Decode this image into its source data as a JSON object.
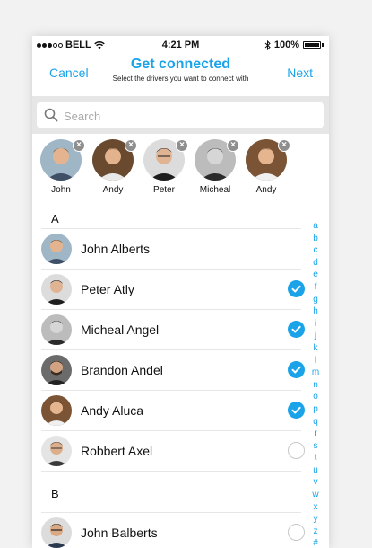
{
  "status_bar": {
    "carrier": "BELL",
    "time": "4:21 PM",
    "battery": "100%"
  },
  "nav": {
    "cancel": "Cancel",
    "title": "Get connected",
    "subtitle": "Select the drivers you want to connect with",
    "next": "Next"
  },
  "search": {
    "placeholder": "Search",
    "value": ""
  },
  "selected": [
    {
      "name": "John"
    },
    {
      "name": "Andy"
    },
    {
      "name": "Peter"
    },
    {
      "name": "Micheal"
    },
    {
      "name": "Andy"
    }
  ],
  "sections": [
    {
      "letter": "A",
      "contacts": [
        {
          "name": "John Alberts",
          "selected": null
        },
        {
          "name": "Peter Atly",
          "selected": true
        },
        {
          "name": "Micheal Angel",
          "selected": true
        },
        {
          "name": "Brandon Andel",
          "selected": true
        },
        {
          "name": "Andy Aluca",
          "selected": true
        },
        {
          "name": "Robbert Axel",
          "selected": false
        }
      ]
    },
    {
      "letter": "B",
      "contacts": [
        {
          "name": "John Balberts",
          "selected": false
        }
      ]
    }
  ],
  "index_letters": [
    "a",
    "b",
    "c",
    "d",
    "e",
    "f",
    "g",
    "h",
    "i",
    "j",
    "k",
    "l",
    "m",
    "n",
    "o",
    "p",
    "q",
    "r",
    "s",
    "t",
    "u",
    "v",
    "w",
    "x",
    "y",
    "z",
    "#"
  ],
  "colors": {
    "accent": "#1aa3e8",
    "divider": "#e6e6e6"
  }
}
